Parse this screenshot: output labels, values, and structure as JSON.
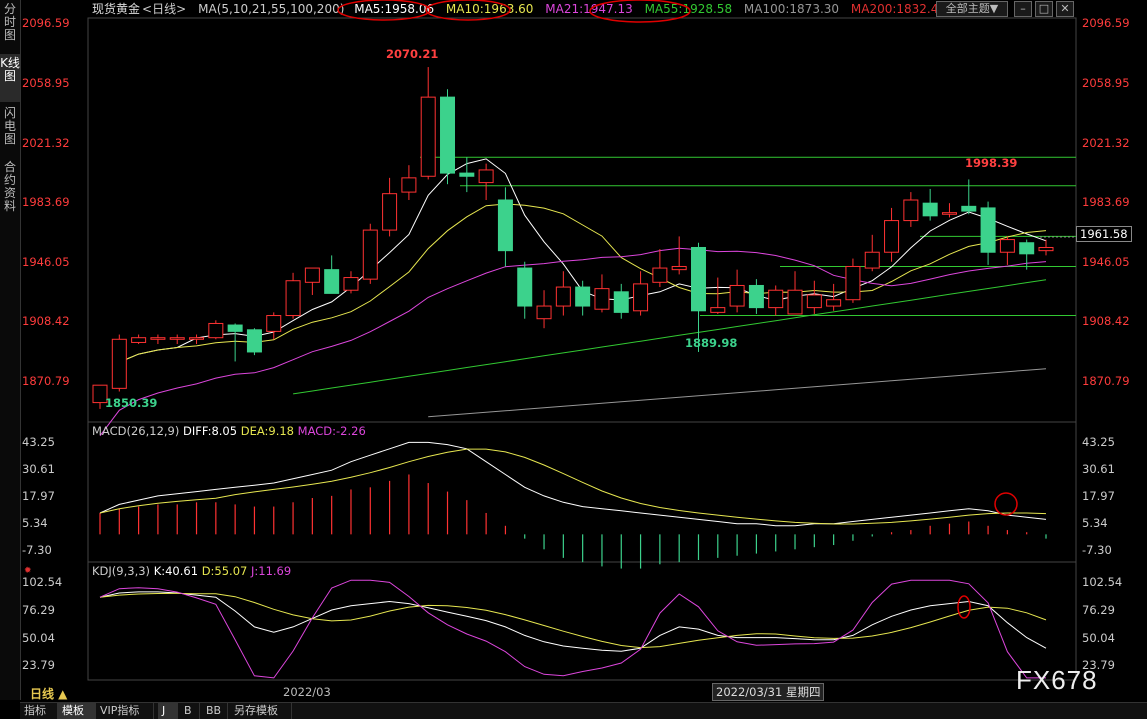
{
  "left_tabs": [
    {
      "label": "分时图",
      "active": false
    },
    {
      "label": "K线图",
      "active": true
    },
    {
      "label": "闪电图",
      "active": false
    },
    {
      "label": "合约资料",
      "active": false
    }
  ],
  "header": {
    "symbol": "现货黄金",
    "period": "<日线>",
    "ma_label": "MA(5,10,21,55,100,200)",
    "ma5": "MA5:1958.06",
    "ma10": "MA10:1963.60",
    "ma21": "MA21:1947.13",
    "ma55": "MA55:1928.58",
    "ma100": "MA100:1873.30",
    "ma200": "MA200:1832.4",
    "theme_button": "全部主题▼"
  },
  "price_axis": [
    "2096.59",
    "2058.95",
    "2021.32",
    "1983.69",
    "1946.05",
    "1908.42",
    "1870.79"
  ],
  "annotations": {
    "high": "2070.21",
    "low_left": "1850.39",
    "low_mid": "1889.98",
    "recent_high": "1998.39",
    "last_price": "1961.58"
  },
  "macd": {
    "title": "MACD(26,12,9)",
    "diff": "DIFF:8.05",
    "dea": "DEA:9.18",
    "macd": "MACD:-2.26",
    "axis": [
      "43.25",
      "30.61",
      "17.97",
      "5.34",
      "-7.30"
    ]
  },
  "kdj": {
    "title": "KDJ(9,3,3)",
    "k": "K:40.61",
    "d": "D:55.07",
    "j": "J:11.69",
    "axis": [
      "102.54",
      "76.29",
      "50.04",
      "23.79"
    ]
  },
  "time_axis": {
    "period_button": "日线 ▲",
    "month_label": "2022/03",
    "cursor_label": "2022/03/31 星期四"
  },
  "watermark": "FX678",
  "bottom_tabs": [
    "指标",
    "模板",
    "VIP指标",
    "J",
    "B",
    "BB",
    "另存模板"
  ],
  "colors": {
    "up": "#ff3232",
    "down": "#3cd28c",
    "ma5": "#ffffff",
    "ma10": "#e6e650",
    "ma21": "#dc46dc",
    "ma55": "#32c832",
    "ma100": "#969696",
    "ma200": "#e03030",
    "highlight_circle": "#e00000"
  },
  "candles": [
    [
      1857,
      1868,
      1866,
      1853
    ],
    [
      1866,
      1897,
      1900,
      1864
    ],
    [
      1895,
      1898,
      1900,
      1894
    ],
    [
      1897,
      1898,
      1900,
      1894
    ],
    [
      1897,
      1898,
      1900,
      1894
    ],
    [
      1897,
      1898,
      1900,
      1894
    ],
    [
      1898,
      1907,
      1909,
      1897
    ],
    [
      1906,
      1902,
      1907,
      1883
    ],
    [
      1903,
      1889,
      1904,
      1887
    ],
    [
      1902,
      1912,
      1914,
      1897
    ],
    [
      1912,
      1934,
      1939,
      1910
    ],
    [
      1933,
      1942,
      1942,
      1925
    ],
    [
      1941,
      1926,
      1950,
      1926
    ],
    [
      1928,
      1936,
      1940,
      1926
    ],
    [
      1935,
      1966,
      1970,
      1932
    ],
    [
      1966,
      1989,
      1999,
      1962
    ],
    [
      1990,
      1999,
      2007,
      1985
    ],
    [
      2000,
      2050,
      2069,
      1998
    ],
    [
      2050,
      2002,
      2055,
      1995
    ],
    [
      2002,
      2000,
      2012,
      1990
    ],
    [
      1996,
      2004,
      2008,
      1985
    ],
    [
      1985,
      1953,
      1993,
      1943
    ],
    [
      1942,
      1918,
      1946,
      1910
    ],
    [
      1910,
      1918,
      1928,
      1904
    ],
    [
      1918,
      1930,
      1940,
      1912
    ],
    [
      1930,
      1918,
      1934,
      1912
    ],
    [
      1916,
      1929,
      1938,
      1914
    ],
    [
      1927,
      1914,
      1932,
      1910
    ],
    [
      1915,
      1932,
      1940,
      1912
    ],
    [
      1933,
      1942,
      1954,
      1930
    ],
    [
      1941,
      1943,
      1962,
      1938
    ],
    [
      1955,
      1915,
      1958,
      1889
    ],
    [
      1914,
      1917,
      1936,
      1913
    ],
    [
      1918,
      1931,
      1941,
      1914
    ],
    [
      1931,
      1917,
      1935,
      1913
    ],
    [
      1917,
      1928,
      1931,
      1912
    ],
    [
      1913,
      1928,
      1940,
      1913
    ],
    [
      1917,
      1925,
      1934,
      1913
    ],
    [
      1918,
      1922,
      1932,
      1915
    ],
    [
      1922,
      1943,
      1948,
      1920
    ],
    [
      1942,
      1952,
      1963,
      1940
    ],
    [
      1952,
      1972,
      1980,
      1946
    ],
    [
      1972,
      1985,
      1990,
      1968
    ],
    [
      1983,
      1975,
      1992,
      1972
    ],
    [
      1976,
      1977,
      1983,
      1974
    ],
    [
      1981,
      1978,
      1998,
      1976
    ],
    [
      1980,
      1952,
      1984,
      1944
    ],
    [
      1952,
      1960,
      1962,
      1944
    ],
    [
      1958,
      1951,
      1960,
      1941
    ],
    [
      1953,
      1955,
      1960,
      1950
    ]
  ],
  "macd_hist": [
    10,
    12,
    13,
    14,
    14,
    15,
    15,
    14,
    13,
    13,
    15,
    17,
    18,
    21,
    22,
    25,
    28,
    24,
    20,
    16,
    10,
    4,
    -2,
    -7,
    -11,
    -13,
    -15,
    -16,
    -16,
    -14,
    -13,
    -12,
    -11,
    -10,
    -9,
    -8,
    -7,
    -6,
    -5,
    -3,
    -1,
    1,
    2,
    4,
    5,
    6,
    4,
    2,
    1,
    -2
  ]
}
